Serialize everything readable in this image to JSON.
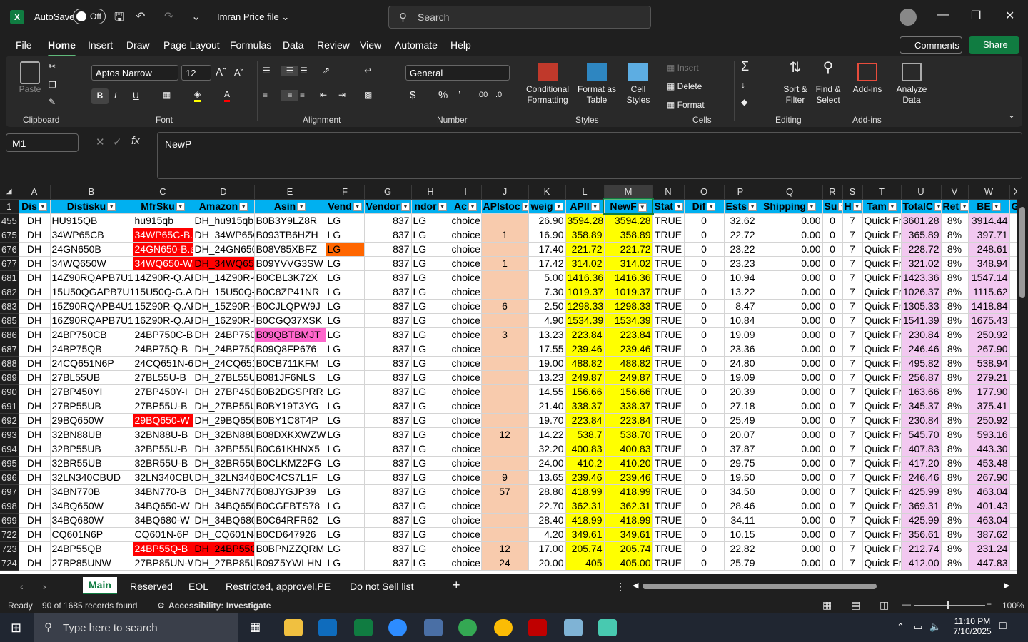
{
  "titlebar": {
    "autosave": "AutoSave",
    "toggle": "Off",
    "filename": "Imran Price file",
    "search": "Search"
  },
  "menu": [
    "File",
    "Home",
    "Insert",
    "Draw",
    "Page Layout",
    "Formulas",
    "Data",
    "Review",
    "View",
    "Automate",
    "Help"
  ],
  "buttons": {
    "comments": "Comments",
    "share": "Share"
  },
  "ribbon": {
    "paste": "Paste",
    "clipboard": "Clipboard",
    "font_name": "Aptos Narrow",
    "font_size": "12",
    "font": "Font",
    "alignment": "Alignment",
    "number_format": "General",
    "number": "Number",
    "cond_fmt": "Conditional Formatting",
    "fmt_table": "Format as Table",
    "cell_styles": "Cell Styles",
    "styles": "Styles",
    "insert": "Insert",
    "delete": "Delete",
    "format": "Format",
    "cells": "Cells",
    "sort": "Sort & Filter",
    "find": "Find & Select",
    "editing": "Editing",
    "addins": "Add-ins",
    "addins_group": "Add-ins",
    "analyze": "Analyze Data"
  },
  "formula_bar": {
    "cell_ref": "M1",
    "content": "NewP"
  },
  "columns": [
    "A",
    "B",
    "C",
    "D",
    "E",
    "F",
    "G",
    "H",
    "I",
    "J",
    "K",
    "L",
    "M",
    "N",
    "O",
    "P",
    "Q",
    "R",
    "S",
    "T",
    "U",
    "V",
    "W",
    "X"
  ],
  "headers": [
    "Dis",
    "Distisku",
    "MfrSku",
    "Amazon",
    "Asin",
    "Vend",
    "Vendor",
    "ndor",
    "Ac",
    "APIstoc",
    "weig",
    "APII",
    "NewF",
    "Stat",
    "Dif",
    "Ests",
    "Shipping",
    "Su",
    "H",
    "Tam",
    "TotalC",
    "Ret",
    "BE",
    "Gl"
  ],
  "rows": [
    [
      "455",
      "DH",
      "HU915QB",
      "hu915qb",
      "DH_hu915qb",
      "B0B3Y9LZ8R",
      "LG",
      "837",
      "LG",
      "choice",
      "",
      "26.90",
      "3594.28",
      "3594.28",
      "TRUE",
      "0",
      "32.62",
      "0.00",
      "0",
      "7",
      "Quick Fr",
      "3601.28",
      "8%",
      "3914.44"
    ],
    [
      "675",
      "DH",
      "34WP65CB",
      "34WP65C-B.A",
      "DH_34WP65C-",
      "B093TB6HZH",
      "LG",
      "837",
      "LG",
      "choice",
      "1",
      "16.90",
      "358.89",
      "358.89",
      "TRUE",
      "0",
      "22.72",
      "0.00",
      "0",
      "7",
      "Quick Fr",
      "365.89",
      "8%",
      "397.71"
    ],
    [
      "676",
      "DH",
      "24GN650B",
      "24GN650-B.a",
      "DH_24GN650-",
      "B08V85XBFZ",
      "LG",
      "837",
      "LG",
      "choice",
      "",
      "17.40",
      "221.72",
      "221.72",
      "TRUE",
      "0",
      "23.22",
      "0.00",
      "0",
      "7",
      "Quick Fr",
      "228.72",
      "8%",
      "248.61"
    ],
    [
      "677",
      "DH",
      "34WQ650W",
      "34WQ650-W.",
      "DH_34WQ650",
      "B09YVVG3SW",
      "LG",
      "837",
      "LG",
      "choice",
      "1",
      "17.42",
      "314.02",
      "314.02",
      "TRUE",
      "0",
      "23.23",
      "0.00",
      "0",
      "7",
      "Quick Fr",
      "321.02",
      "8%",
      "348.94"
    ],
    [
      "681",
      "DH",
      "14Z90RQAPB7U1",
      "14Z90R-Q.AP",
      "DH_14Z90R-Q",
      "B0CBL3K72X",
      "LG",
      "837",
      "LG",
      "choice",
      "",
      "5.00",
      "1416.36",
      "1416.36",
      "TRUE",
      "0",
      "10.94",
      "0.00",
      "0",
      "7",
      "Quick Fr",
      "1423.36",
      "8%",
      "1547.14"
    ],
    [
      "682",
      "DH",
      "15U50QGAPB7U1",
      "15U50Q-G.AP",
      "DH_15U50Q-G",
      "B0C8ZP41NR",
      "LG",
      "837",
      "LG",
      "choice",
      "",
      "7.30",
      "1019.37",
      "1019.37",
      "TRUE",
      "0",
      "13.22",
      "0.00",
      "0",
      "7",
      "Quick Fr",
      "1026.37",
      "8%",
      "1115.62"
    ],
    [
      "683",
      "DH",
      "15Z90RQAPB4U1",
      "15Z90R-Q.AP",
      "DH_15Z90R-Q",
      "B0CJLQPW9J",
      "LG",
      "837",
      "LG",
      "choice",
      "6",
      "2.50",
      "1298.33",
      "1298.33",
      "TRUE",
      "0",
      "8.47",
      "0.00",
      "0",
      "7",
      "Quick Fr",
      "1305.33",
      "8%",
      "1418.84"
    ],
    [
      "685",
      "DH",
      "16Z90RQAPB7U1",
      "16Z90R-Q.AP",
      "DH_16Z90R-Q",
      "B0CGQ37XSK",
      "LG",
      "837",
      "LG",
      "choice",
      "",
      "4.90",
      "1534.39",
      "1534.39",
      "TRUE",
      "0",
      "10.84",
      "0.00",
      "0",
      "7",
      "Quick Fr",
      "1541.39",
      "8%",
      "1675.43"
    ],
    [
      "686",
      "DH",
      "24BP750CB",
      "24BP750C-B",
      "DH_24BP750C",
      "B09QBTBMJT",
      "LG",
      "837",
      "LG",
      "choice",
      "3",
      "13.23",
      "223.84",
      "223.84",
      "TRUE",
      "0",
      "19.09",
      "0.00",
      "0",
      "7",
      "Quick Fr",
      "230.84",
      "8%",
      "250.92"
    ],
    [
      "687",
      "DH",
      "24BP75QB",
      "24BP75Q-B",
      "DH_24BP75Q-",
      "B09Q8FP676",
      "LG",
      "837",
      "LG",
      "choice",
      "",
      "17.55",
      "239.46",
      "239.46",
      "TRUE",
      "0",
      "23.36",
      "0.00",
      "0",
      "7",
      "Quick Fr",
      "246.46",
      "8%",
      "267.90"
    ],
    [
      "688",
      "DH",
      "24CQ651N6P",
      "24CQ651N-6F",
      "DH_24CQ651N",
      "B0CB711KFM",
      "LG",
      "837",
      "LG",
      "choice",
      "",
      "19.00",
      "488.82",
      "488.82",
      "TRUE",
      "0",
      "24.80",
      "0.00",
      "0",
      "7",
      "Quick Fr",
      "495.82",
      "8%",
      "538.94"
    ],
    [
      "689",
      "DH",
      "27BL55UB",
      "27BL55U-B",
      "DH_27BL55U-",
      "B081JF6NLS",
      "LG",
      "837",
      "LG",
      "choice",
      "",
      "13.23",
      "249.87",
      "249.87",
      "TRUE",
      "0",
      "19.09",
      "0.00",
      "0",
      "7",
      "Quick Fr",
      "256.87",
      "8%",
      "279.21"
    ],
    [
      "690",
      "DH",
      "27BP450YI",
      "27BP450Y-I",
      "DH_27BP450Y",
      "B0B2DGSPRR",
      "LG",
      "837",
      "LG",
      "choice",
      "",
      "14.55",
      "156.66",
      "156.66",
      "TRUE",
      "0",
      "20.39",
      "0.00",
      "0",
      "7",
      "Quick Fr",
      "163.66",
      "8%",
      "177.90"
    ],
    [
      "691",
      "DH",
      "27BP55UB",
      "27BP55U-B",
      "DH_27BP55U-",
      "B0BY19T3YG",
      "LG",
      "837",
      "LG",
      "choice",
      "",
      "21.40",
      "338.37",
      "338.37",
      "TRUE",
      "0",
      "27.18",
      "0.00",
      "0",
      "7",
      "Quick Fr",
      "345.37",
      "8%",
      "375.41"
    ],
    [
      "692",
      "DH",
      "29BQ650W",
      "29BQ650-W",
      "DH_29BQ650-",
      "B0BY1C8T4P",
      "LG",
      "837",
      "LG",
      "choice",
      "",
      "19.70",
      "223.84",
      "223.84",
      "TRUE",
      "0",
      "25.49",
      "0.00",
      "0",
      "7",
      "Quick Fr",
      "230.84",
      "8%",
      "250.92"
    ],
    [
      "693",
      "DH",
      "32BN88UB",
      "32BN88U-B",
      "DH_32BN88U-",
      "B08DXKXWZW",
      "LG",
      "837",
      "LG",
      "choice",
      "12",
      "14.22",
      "538.7",
      "538.70",
      "TRUE",
      "0",
      "20.07",
      "0.00",
      "0",
      "7",
      "Quick Fr",
      "545.70",
      "8%",
      "593.16"
    ],
    [
      "694",
      "DH",
      "32BP55UB",
      "32BP55U-B",
      "DH_32BP55U-",
      "B0C61KHNX5",
      "LG",
      "837",
      "LG",
      "choice",
      "",
      "32.20",
      "400.83",
      "400.83",
      "TRUE",
      "0",
      "37.87",
      "0.00",
      "0",
      "7",
      "Quick Fr",
      "407.83",
      "8%",
      "443.30"
    ],
    [
      "695",
      "DH",
      "32BR55UB",
      "32BR55U-B",
      "DH_32BR55U-",
      "B0CLKMZ2FG",
      "LG",
      "837",
      "LG",
      "choice",
      "",
      "24.00",
      "410.2",
      "410.20",
      "TRUE",
      "0",
      "29.75",
      "0.00",
      "0",
      "7",
      "Quick Fr",
      "417.20",
      "8%",
      "453.48"
    ],
    [
      "696",
      "DH",
      "32LN340CBUD",
      "32LN340CBUI",
      "DH_32LN340C",
      "B0C4CS7L1F",
      "LG",
      "837",
      "LG",
      "choice",
      "9",
      "13.65",
      "239.46",
      "239.46",
      "TRUE",
      "0",
      "19.50",
      "0.00",
      "0",
      "7",
      "Quick Fr",
      "246.46",
      "8%",
      "267.90"
    ],
    [
      "697",
      "DH",
      "34BN770B",
      "34BN770-B",
      "DH_34BN770-",
      "B08JYGJP39",
      "LG",
      "837",
      "LG",
      "choice",
      "57",
      "28.80",
      "418.99",
      "418.99",
      "TRUE",
      "0",
      "34.50",
      "0.00",
      "0",
      "7",
      "Quick Fr",
      "425.99",
      "8%",
      "463.04"
    ],
    [
      "698",
      "DH",
      "34BQ650W",
      "34BQ650-W",
      "DH_34BQ650-",
      "B0CGFBTS78",
      "LG",
      "837",
      "LG",
      "choice",
      "",
      "22.70",
      "362.31",
      "362.31",
      "TRUE",
      "0",
      "28.46",
      "0.00",
      "0",
      "7",
      "Quick Fr",
      "369.31",
      "8%",
      "401.43"
    ],
    [
      "699",
      "DH",
      "34BQ680W",
      "34BQ680-W",
      "DH_34BQ680-",
      "B0C64RFR62",
      "LG",
      "837",
      "LG",
      "choice",
      "",
      "28.40",
      "418.99",
      "418.99",
      "TRUE",
      "0",
      "34.11",
      "0.00",
      "0",
      "7",
      "Quick Fr",
      "425.99",
      "8%",
      "463.04"
    ],
    [
      "722",
      "DH",
      "CQ601N6P",
      "CQ601N-6P",
      "DH_CQ601N-6",
      "B0CD647926",
      "LG",
      "837",
      "LG",
      "choice",
      "",
      "4.20",
      "349.61",
      "349.61",
      "TRUE",
      "0",
      "10.15",
      "0.00",
      "0",
      "7",
      "Quick Fr",
      "356.61",
      "8%",
      "387.62"
    ],
    [
      "723",
      "DH",
      "24BP55QB",
      "24BP55Q-B",
      "DH_24BP55Q",
      "B0BPNZZQRM",
      "LG",
      "837",
      "LG",
      "choice",
      "12",
      "17.00",
      "205.74",
      "205.74",
      "TRUE",
      "0",
      "22.82",
      "0.00",
      "0",
      "7",
      "Quick Fr",
      "212.74",
      "8%",
      "231.24"
    ],
    [
      "724",
      "DH",
      "27BP85UNW",
      "27BP85UN-W",
      "DH_27BP85UN",
      "B09Z5YWLHN",
      "LG",
      "837",
      "LG",
      "choice",
      "24",
      "20.00",
      "405",
      "405.00",
      "TRUE",
      "0",
      "25.79",
      "0.00",
      "0",
      "7",
      "Quick Fr",
      "412.00",
      "8%",
      "447.83"
    ]
  ],
  "red_mfr_rows": [
    "675",
    "676",
    "677",
    "692",
    "723"
  ],
  "red_amz_rows": [
    "677",
    "723"
  ],
  "pink_asin_rows": [
    "686"
  ],
  "orange_vend_rows": [
    "676"
  ],
  "sheets": [
    "Main",
    "Reserved",
    "EOL",
    "Restricted, approvel,PE",
    "Do not Sell list"
  ],
  "status": {
    "ready": "Ready",
    "records": "90 of 1685 records found",
    "accessibility": "Accessibility: Investigate",
    "zoom": "100%"
  },
  "taskbar": {
    "search": "Type here to search",
    "time": "11:10 PM",
    "date": "7/10/2025"
  },
  "colors": {
    "header_fill": "#00b0f0",
    "yellow": "#ffff00",
    "peach": "#f8cbad",
    "lavender": "#f2c8f0",
    "red": "#ff0000",
    "accent": "#107c41"
  }
}
